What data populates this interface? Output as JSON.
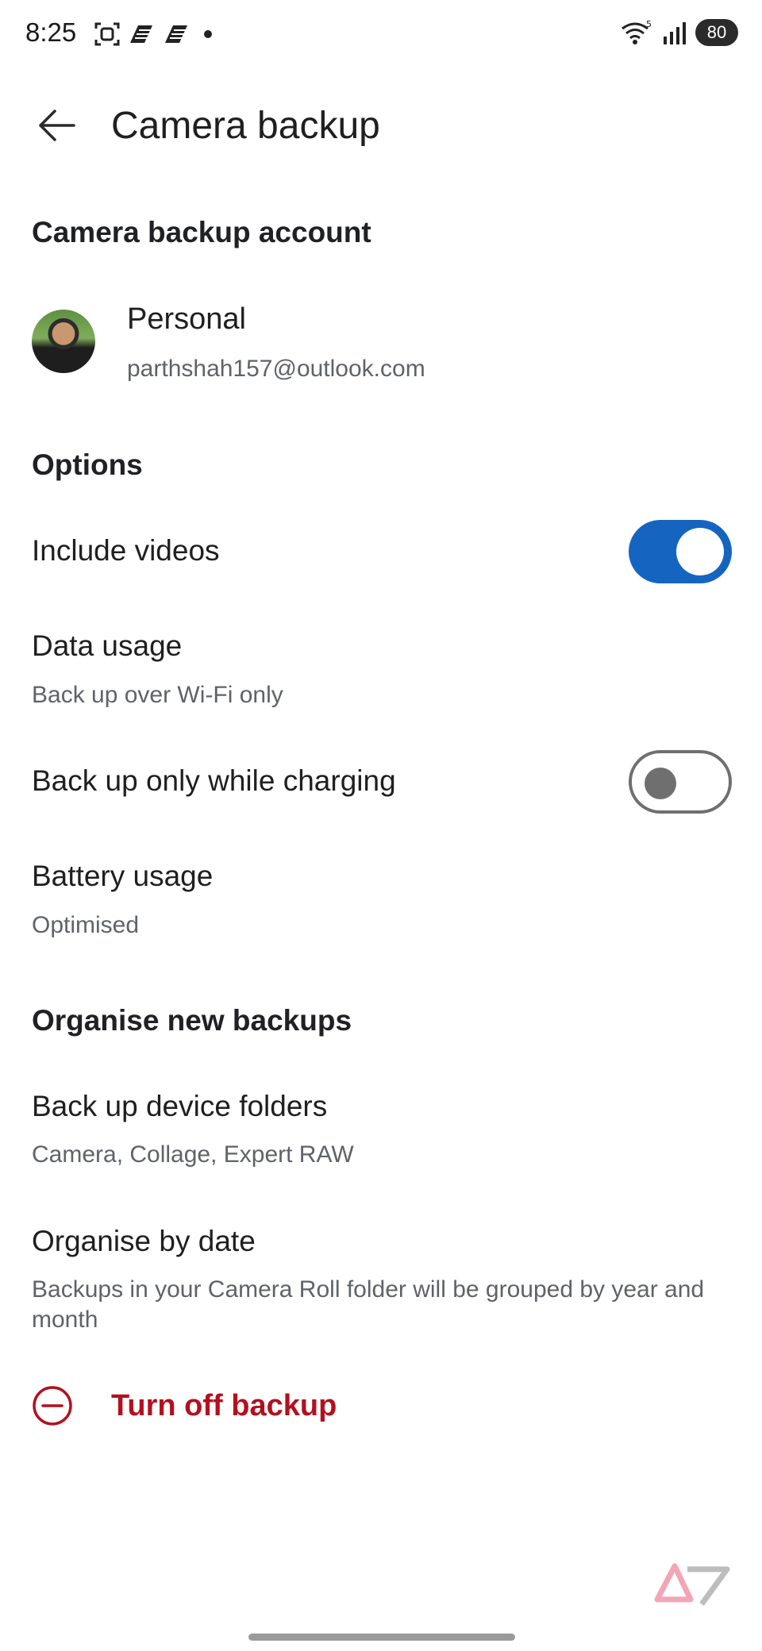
{
  "status_bar": {
    "time": "8:25",
    "battery": "80",
    "icons": [
      "screenshot-icon",
      "app-icon",
      "app-icon",
      "dot-icon",
      "wifi-icon",
      "signal-icon"
    ]
  },
  "header": {
    "title": "Camera backup",
    "back_icon": "arrow-left-icon"
  },
  "account_section": {
    "title": "Camera backup account",
    "account": {
      "name": "Personal",
      "email": "parthshah157@outlook.com"
    }
  },
  "options_section": {
    "title": "Options",
    "include_videos": {
      "label": "Include videos",
      "enabled": true
    },
    "data_usage": {
      "label": "Data usage",
      "value": "Back up over Wi-Fi only"
    },
    "charging_only": {
      "label": "Back up only while charging",
      "enabled": false
    },
    "battery_usage": {
      "label": "Battery usage",
      "value": "Optimised"
    }
  },
  "organise_section": {
    "title": "Organise new backups",
    "device_folders": {
      "label": "Back up device folders",
      "value": "Camera, Collage, Expert RAW"
    },
    "by_date": {
      "label": "Organise by date",
      "description": "Backups in your Camera Roll folder will be grouped by year and month"
    }
  },
  "turn_off": {
    "label": "Turn off backup",
    "icon": "minus-circle-icon"
  },
  "colors": {
    "accent": "#1565c0",
    "danger": "#b3101f",
    "secondary_text": "#5f6368"
  }
}
